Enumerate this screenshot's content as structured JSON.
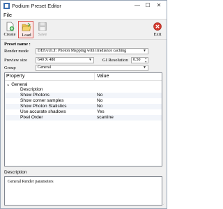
{
  "window": {
    "title": "Podium Preset Editor",
    "minimize": "—",
    "maximize": "☐",
    "close": "✕"
  },
  "menu": {
    "file": "File"
  },
  "toolbar": {
    "create": "Create",
    "load": "Load",
    "save": "Save",
    "exit": "Exit"
  },
  "form": {
    "preset_name_label": "Preset name :",
    "render_mode_label": "Render mode",
    "render_mode_value": "DEFAULT: Photon Mapping with irradiance caching",
    "preview_size_label": "Preview size",
    "preview_size_value": "640 X 480",
    "gi_resolution_label": "GI Resolution",
    "gi_resolution_value": "0.50",
    "group_label": "Group",
    "group_value": "General"
  },
  "grid": {
    "col_property": "Property",
    "col_value": "Value",
    "category": "General",
    "category_toggle": "⌄",
    "rows": [
      {
        "property": "Description",
        "value": ""
      },
      {
        "property": "Show Photons",
        "value": "No"
      },
      {
        "property": "Show corner samples",
        "value": "No"
      },
      {
        "property": "Show Photon Statistics",
        "value": "No"
      },
      {
        "property": "Use accurate shadows",
        "value": "Yes"
      },
      {
        "property": "Pixel Order",
        "value": "scanline"
      }
    ]
  },
  "description": {
    "label": "Description",
    "text": "General Render parameters"
  },
  "colors": {
    "accent_red": "#d9534f",
    "folder_yellow": "#e8c04a",
    "exit_red": "#d33a2f"
  },
  "icons": {
    "create": "new-document-icon",
    "load": "open-folder-icon",
    "save": "floppy-disk-icon",
    "exit": "exit-icon"
  }
}
